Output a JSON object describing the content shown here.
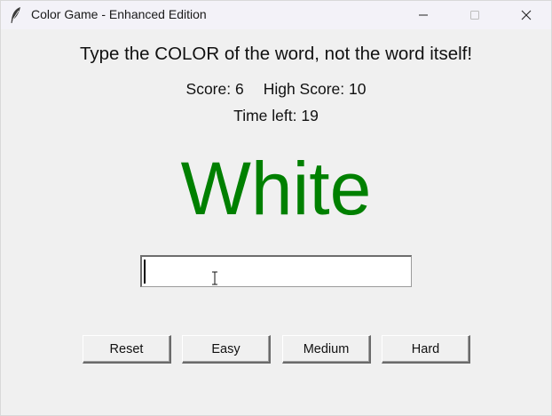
{
  "window": {
    "title": "Color Game - Enhanced Edition",
    "icon": "feather-icon",
    "controls": [
      "minimize-icon",
      "maximize-icon",
      "close-icon"
    ]
  },
  "game": {
    "instruction": "Type the COLOR of the word, not the word itself!",
    "score_text": "Score: 6",
    "high_score_text": "High Score: 10",
    "timer_text": "Time left: 19",
    "word": "White",
    "word_color": "#008000",
    "input_value": ""
  },
  "buttons": {
    "reset": "Reset",
    "easy": "Easy",
    "medium": "Medium",
    "hard": "Hard"
  }
}
